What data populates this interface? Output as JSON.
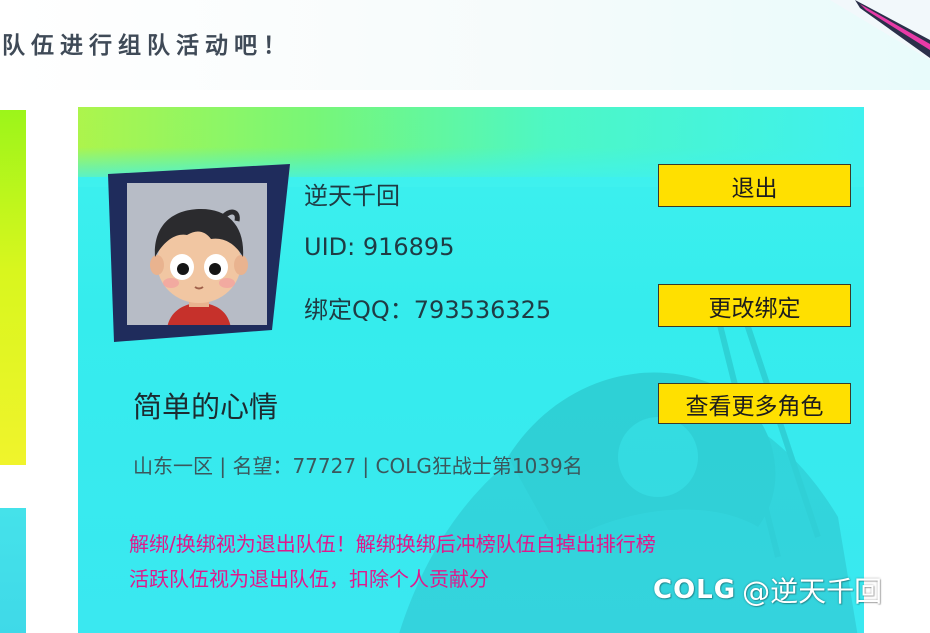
{
  "banner": {
    "text": "队伍进行组队活动吧！"
  },
  "profile": {
    "nickname": "逆天千回",
    "uid": "UID: 916895",
    "bound_qq": "绑定QQ：793536325"
  },
  "buttons": {
    "logout": "退出",
    "change_binding": "更改绑定",
    "view_more_characters": "查看更多角色"
  },
  "character": {
    "name": "简单的心情",
    "stats": "山东一区 | 名望：77727 | COLG狂战士第1039名"
  },
  "notices": [
    "解绑/换绑视为退出队伍！解绑换绑后冲榜队伍自掉出排行榜",
    "活跃队伍视为退出队伍，扣除个人贡献分"
  ],
  "watermark": {
    "logo": "COLG",
    "user": "@逆天千回"
  },
  "colors": {
    "card_background": "#3ff1ee",
    "button_yellow": "#ffe000",
    "notice_pink": "#e0198c",
    "frame_navy": "#1f2c5c"
  },
  "icons": {
    "avatar": "cartoon-boy-avatar"
  }
}
